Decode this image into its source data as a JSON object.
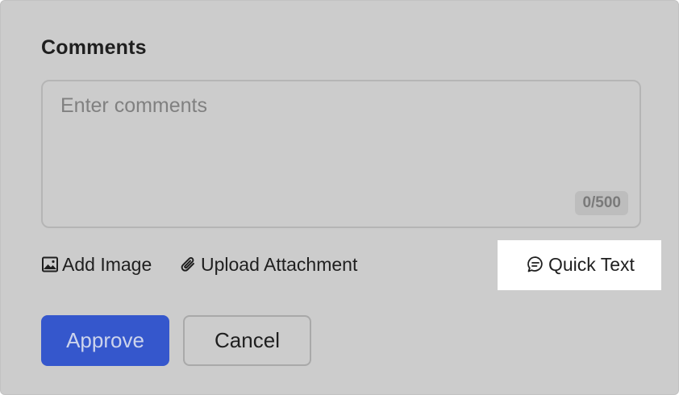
{
  "form": {
    "title": "Comments",
    "comment_placeholder": "Enter comments",
    "comment_value": "",
    "counter": "0/500"
  },
  "actions": {
    "add_image": {
      "label": "Add Image",
      "icon": "image-icon"
    },
    "upload_attachment": {
      "label": "Upload Attachment",
      "icon": "paperclip-icon"
    },
    "quick_text": {
      "label": "Quick Text",
      "icon": "chat-bubble-icon"
    }
  },
  "buttons": {
    "approve": "Approve",
    "cancel": "Cancel"
  },
  "colors": {
    "panel_bg": "#cccccc",
    "primary": "#3557cc",
    "highlight": "#ffffff"
  }
}
